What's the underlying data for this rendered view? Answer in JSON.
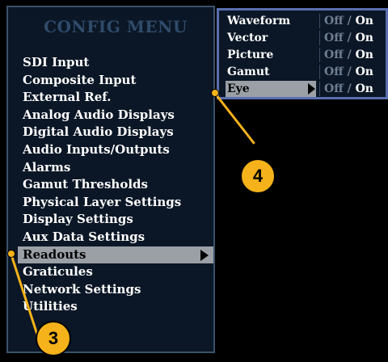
{
  "menu": {
    "title": "CONFIG MENU",
    "items": [
      {
        "label": "SDI Input"
      },
      {
        "label": "Composite Input"
      },
      {
        "label": "External Ref."
      },
      {
        "label": "Analog Audio Displays"
      },
      {
        "label": "Digital Audio Displays"
      },
      {
        "label": "Audio Inputs/Outputs"
      },
      {
        "label": "Alarms"
      },
      {
        "label": "Gamut Thresholds"
      },
      {
        "label": "Physical Layer Settings"
      },
      {
        "label": "Display Settings"
      },
      {
        "label": "Aux Data Settings"
      },
      {
        "label": "Readouts",
        "selected": true
      },
      {
        "label": "Graticules"
      },
      {
        "label": "Network Settings"
      },
      {
        "label": "Utilities"
      }
    ]
  },
  "submenu": {
    "rows": [
      {
        "label": "Waveform",
        "off": "Off",
        "sep": "/",
        "on": "On"
      },
      {
        "label": "Vector",
        "off": "Off",
        "sep": "/",
        "on": "On"
      },
      {
        "label": "Picture",
        "off": "Off",
        "sep": "/",
        "on": "On"
      },
      {
        "label": "Gamut",
        "off": "Off",
        "sep": "/",
        "on": "On"
      },
      {
        "label": "Eye",
        "off": "Off",
        "sep": "/",
        "on": "On",
        "selected": true
      }
    ]
  },
  "callouts": {
    "left": "3",
    "right": "4"
  },
  "colors": {
    "panel_bg": "#0b1726",
    "selection": "#9aa0a6",
    "callout": "#f5b21a",
    "submenu_border": "#5a6fb0"
  }
}
